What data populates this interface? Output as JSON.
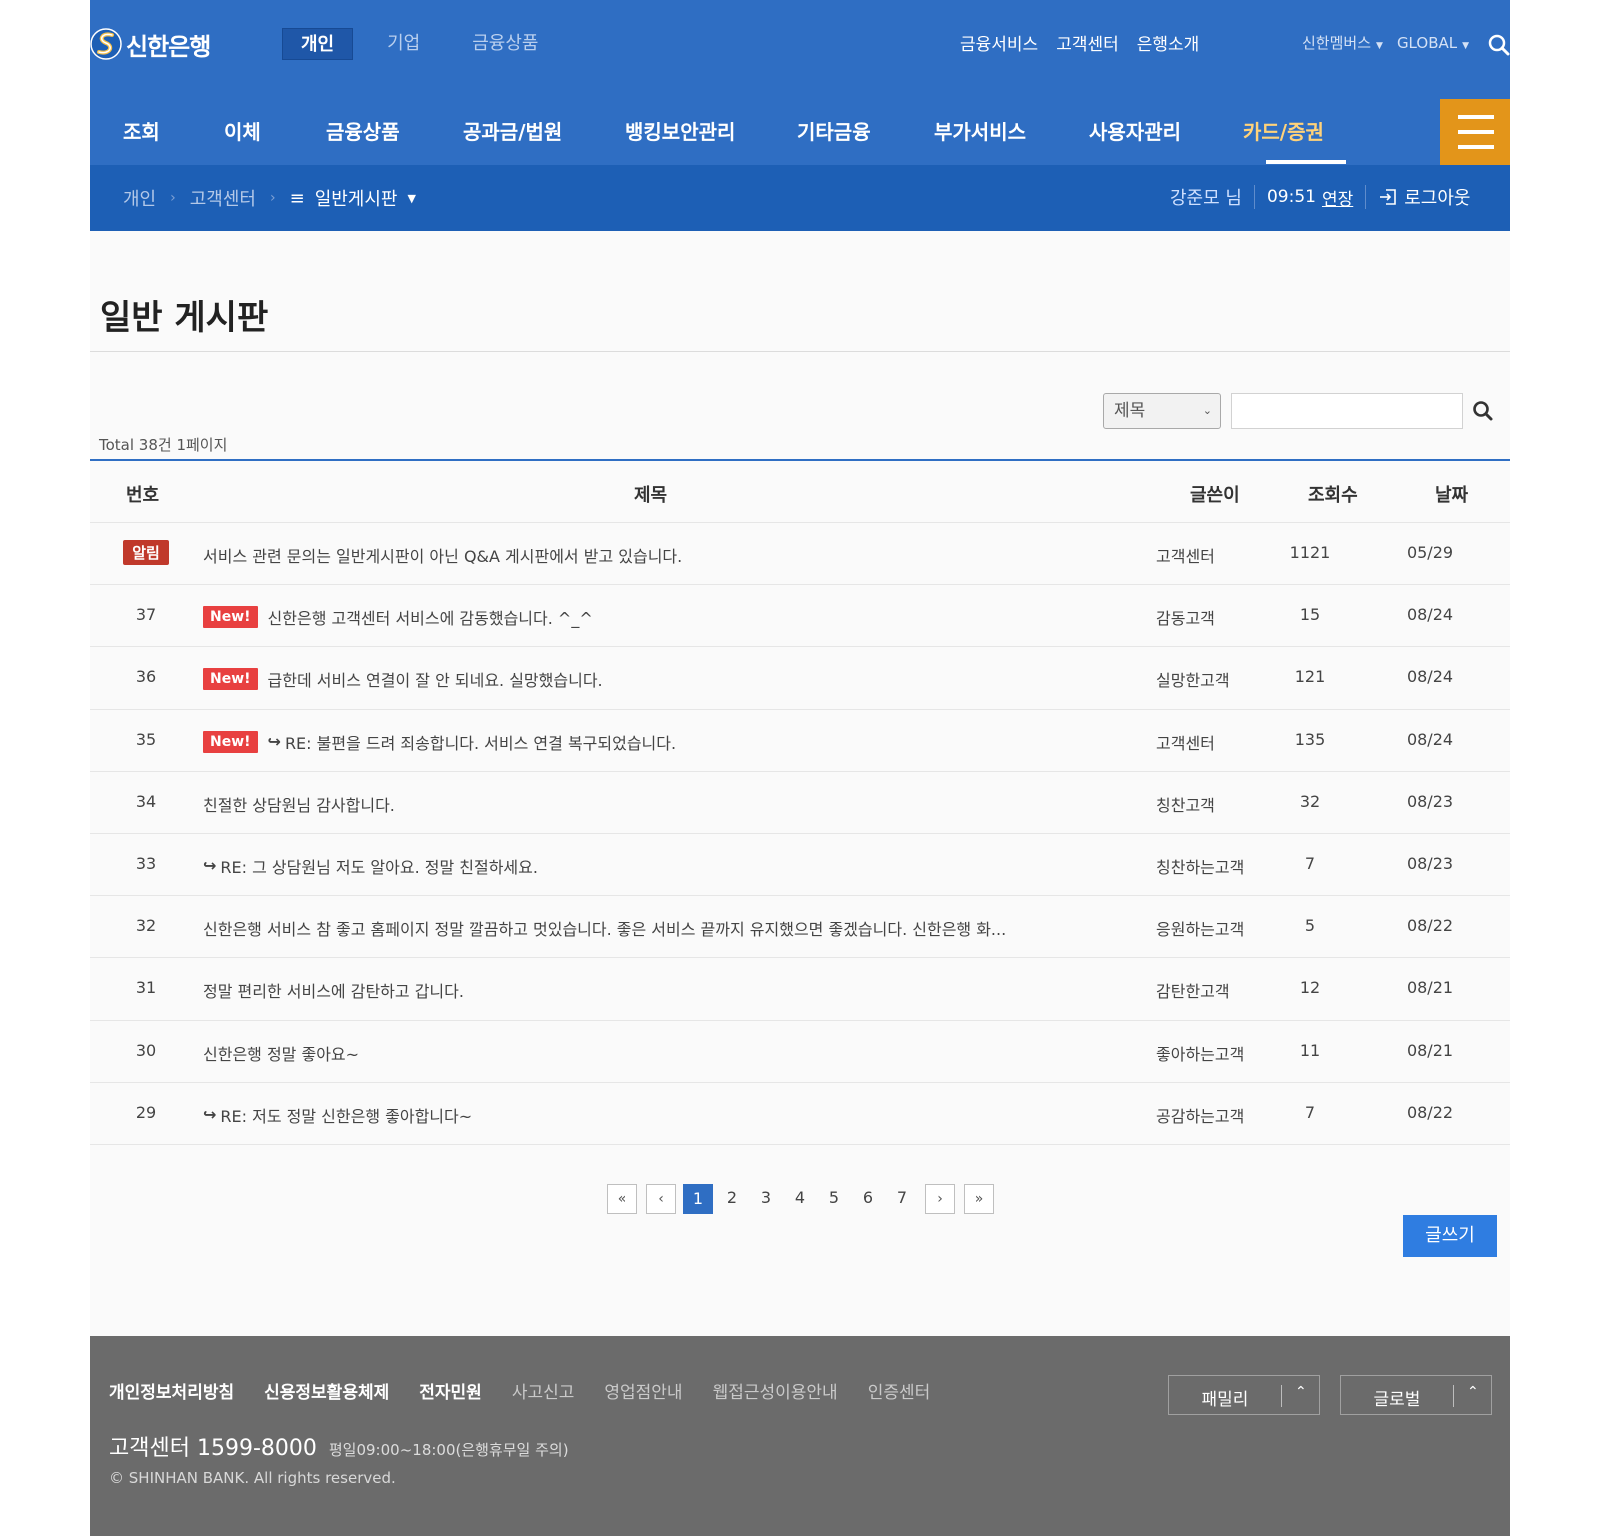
{
  "brand": {
    "name": "신한은행"
  },
  "seg_tabs": [
    "개인",
    "기업",
    "금융상품"
  ],
  "util_links": [
    "금융서비스",
    "고객센터",
    "은행소개"
  ],
  "global_links": [
    "신한멤버스",
    "GLOBAL"
  ],
  "main_nav": [
    "조회",
    "이체",
    "금융상품",
    "공과금/법원",
    "뱅킹보안관리",
    "기타금융",
    "부가서비스",
    "사용자관리",
    "카드/증권"
  ],
  "breadcrumb": {
    "items": [
      "개인",
      "고객센터"
    ],
    "current": "일반게시판"
  },
  "user": {
    "name": "강준모 님",
    "timer": "09:51",
    "extend": "연장",
    "logout": "로그아웃"
  },
  "page": {
    "title": "일반 게시판"
  },
  "search": {
    "field": "제목",
    "placeholder": ""
  },
  "total": "Total 38건 1페이지",
  "table": {
    "headers": {
      "no": "번호",
      "title": "제목",
      "writer": "글쓴이",
      "views": "조회수",
      "date": "날짜"
    },
    "rows": [
      {
        "no": "",
        "notice": "알림",
        "new": "",
        "reply": "",
        "title": "서비스 관련 문의는 일반게시판이 아닌 Q&A 게시판에서 받고 있습니다.",
        "writer": "고객센터",
        "views": "1121",
        "date": "05/29"
      },
      {
        "no": "37",
        "notice": "",
        "new": "New!",
        "reply": "",
        "title": "신한은행 고객센터 서비스에 감동했습니다. ^_^",
        "writer": "감동고객",
        "views": "15",
        "date": "08/24"
      },
      {
        "no": "36",
        "notice": "",
        "new": "New!",
        "reply": "",
        "title": "급한데 서비스 연결이 잘 안 되네요. 실망했습니다.",
        "writer": "실망한고객",
        "views": "121",
        "date": "08/24"
      },
      {
        "no": "35",
        "notice": "",
        "new": "New!",
        "reply": "↪",
        "title": "RE: 불편을 드려 죄송합니다. 서비스 연결 복구되었습니다.",
        "writer": "고객센터",
        "views": "135",
        "date": "08/24"
      },
      {
        "no": "34",
        "notice": "",
        "new": "",
        "reply": "",
        "title": "친절한 상담원님 감사합니다.",
        "writer": "칭찬고객",
        "views": "32",
        "date": "08/23"
      },
      {
        "no": "33",
        "notice": "",
        "new": "",
        "reply": "↪",
        "title": "RE: 그 상담원님 저도 알아요. 정말 친절하세요.",
        "writer": "칭찬하는고객",
        "views": "7",
        "date": "08/23"
      },
      {
        "no": "32",
        "notice": "",
        "new": "",
        "reply": "",
        "title": "신한은행 서비스 참 좋고 홈페이지 정말 깔끔하고 멋있습니다. 좋은 서비스 끝까지 유지했으면 좋겠습니다. 신한은행 화...",
        "writer": "응원하는고객",
        "views": "5",
        "date": "08/22"
      },
      {
        "no": "31",
        "notice": "",
        "new": "",
        "reply": "",
        "title": "정말 편리한 서비스에 감탄하고 갑니다.",
        "writer": "감탄한고객",
        "views": "12",
        "date": "08/21"
      },
      {
        "no": "30",
        "notice": "",
        "new": "",
        "reply": "",
        "title": "신한은행 정말 좋아요~",
        "writer": "좋아하는고객",
        "views": "11",
        "date": "08/21"
      },
      {
        "no": "29",
        "notice": "",
        "new": "",
        "reply": "↪",
        "title": "RE: 저도 정말 신한은행 좋아합니다~",
        "writer": "공감하는고객",
        "views": "7",
        "date": "08/22"
      }
    ]
  },
  "pagination": {
    "first": "«",
    "prev": "‹",
    "pages": [
      "1",
      "2",
      "3",
      "4",
      "5",
      "6",
      "7"
    ],
    "current": "1",
    "next": "›",
    "last": "»"
  },
  "write_button": "글쓰기",
  "footer": {
    "links_strong": [
      "개인정보처리방침",
      "신용정보활용체제",
      "전자민원"
    ],
    "links": [
      "사고신고",
      "영업점안내",
      "웹접근성이용안내",
      "인증센터"
    ],
    "phone": "고객센터 1599-8000",
    "hours": "평일09:00~18:00(은행휴무일 주의)",
    "copyright": "© SHINHAN BANK. All rights reserved.",
    "family": "패밀리",
    "global": "글로벌"
  },
  "colors": {
    "primary": "#2f6ec3",
    "breadcrumb": "#1d5fb5",
    "menu_button": "#e3951a",
    "new_badge": "#e84040",
    "notice_badge": "#c0392b",
    "footer": "#6b6b6b"
  },
  "icons": [
    "shinhan-logo",
    "search-icon",
    "hamburger-menu-icon",
    "logout-icon"
  ]
}
